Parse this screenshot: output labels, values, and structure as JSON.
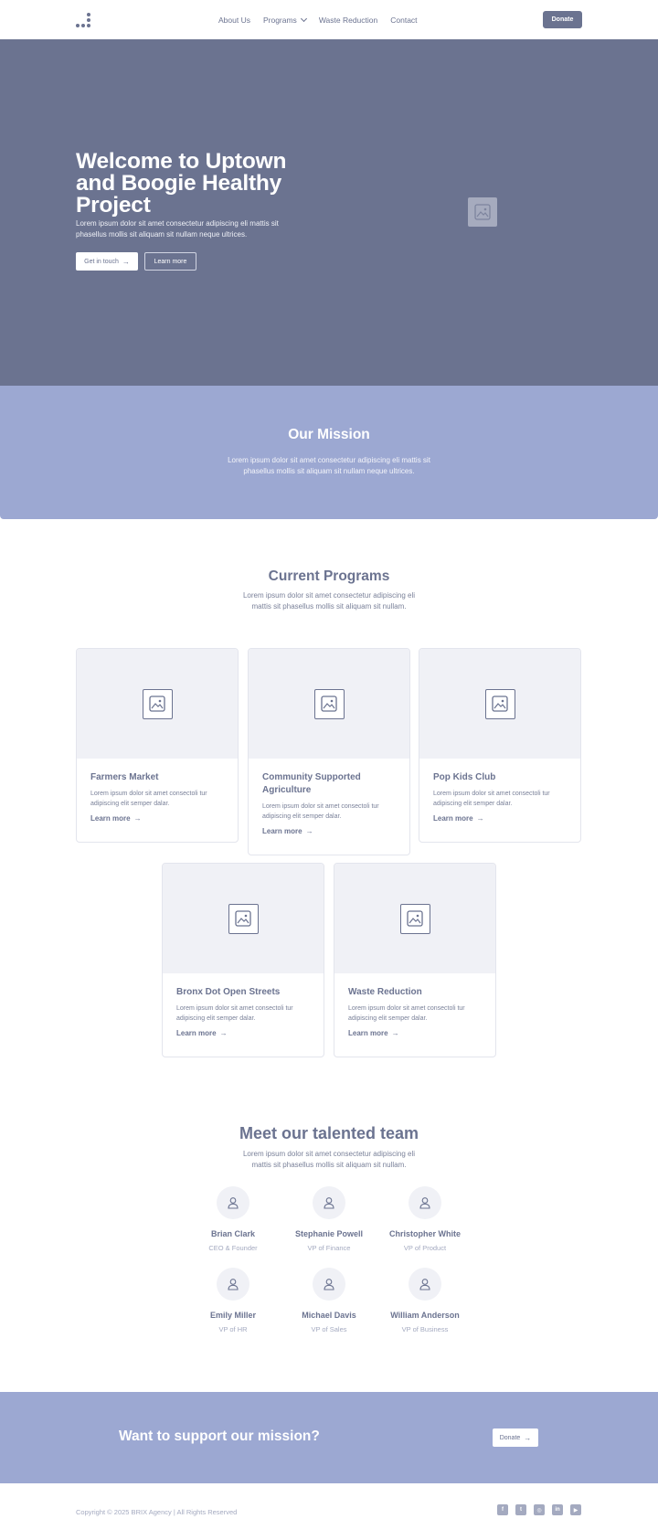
{
  "nav": {
    "links": [
      {
        "label": "About Us"
      },
      {
        "label": "Programs"
      },
      {
        "label": "Waste Reduction"
      },
      {
        "label": "Contact"
      }
    ],
    "donate_label": "Donate"
  },
  "hero": {
    "title": "Welcome to Uptown and Boogie Healthy Project",
    "description": "Lorem ipsum dolor sit amet consectetur adipiscing eli mattis sit phasellus mollis sit aliquam sit nullam neque ultrices.",
    "primary_label": "Get in touch",
    "primary_icon": "→",
    "secondary_label": "Learn more"
  },
  "mission": {
    "title": "Our Mission",
    "description": "Lorem ipsum dolor sit amet consectetur adipiscing eli mattis sit phasellus mollis sit aliquam sit nullam neque ultrices."
  },
  "programs": {
    "title": "Current Programs",
    "description": "Lorem ipsum dolor sit amet consectetur adipiscing eli mattis sit phasellus mollis sit aliquam sit nullam.",
    "link_arrow": "→",
    "cards": [
      {
        "title": "Farmers Market",
        "description": "Lorem ipsum dolor sit amet consectoli tur adipiscing elit semper dalar.",
        "link": "Learn more"
      },
      {
        "title": "Community Supported Agriculture",
        "description": "Lorem ipsum dolor sit amet consectoli tur adipiscing elit semper dalar.",
        "link": "Learn more"
      },
      {
        "title": "Pop Kids Club",
        "description": "Lorem ipsum dolor sit amet consectoli tur adipiscing elit semper dalar.",
        "link": "Learn more"
      },
      {
        "title": "Bronx Dot Open Streets",
        "description": "Lorem ipsum dolor sit amet consectoli tur adipiscing elit semper dalar.",
        "link": "Learn more"
      },
      {
        "title": "Waste Reduction",
        "description": "Lorem ipsum dolor sit amet consectoli tur adipiscing elit semper dalar.",
        "link": "Learn more"
      }
    ]
  },
  "team": {
    "title": "Meet our talented team",
    "description": "Lorem ipsum dolor sit amet consectetur adipiscing eli mattis sit phasellus mollis sit aliquam sit nullam.",
    "members": [
      {
        "name": "Brian Clark",
        "role": "CEO & Founder"
      },
      {
        "name": "Stephanie Powell",
        "role": "VP of Finance"
      },
      {
        "name": "Christopher White",
        "role": "VP of Product"
      },
      {
        "name": "Emily Miller",
        "role": "VP of HR"
      },
      {
        "name": "Michael Davis",
        "role": "VP of Sales"
      },
      {
        "name": "William Anderson",
        "role": "VP of Business"
      }
    ]
  },
  "cta": {
    "title": "Want to support our mission?",
    "button_label": "Donate",
    "button_icon": "→"
  },
  "footer": {
    "copyright": "Copyright © 2025 BRIX Agency | All Rights Reserved",
    "socials": [
      {
        "icon": "facebook-icon",
        "glyph": "f"
      },
      {
        "icon": "twitter-icon",
        "glyph": "t"
      },
      {
        "icon": "instagram-icon",
        "glyph": "◎"
      },
      {
        "icon": "linkedin-icon",
        "glyph": "in"
      },
      {
        "icon": "youtube-icon",
        "glyph": "▶"
      }
    ]
  },
  "colors": {
    "primary": "#6b7390",
    "accent": "#9ca8d2",
    "card_media": "#f0f1f6",
    "muted_text": "#a4aac0"
  }
}
